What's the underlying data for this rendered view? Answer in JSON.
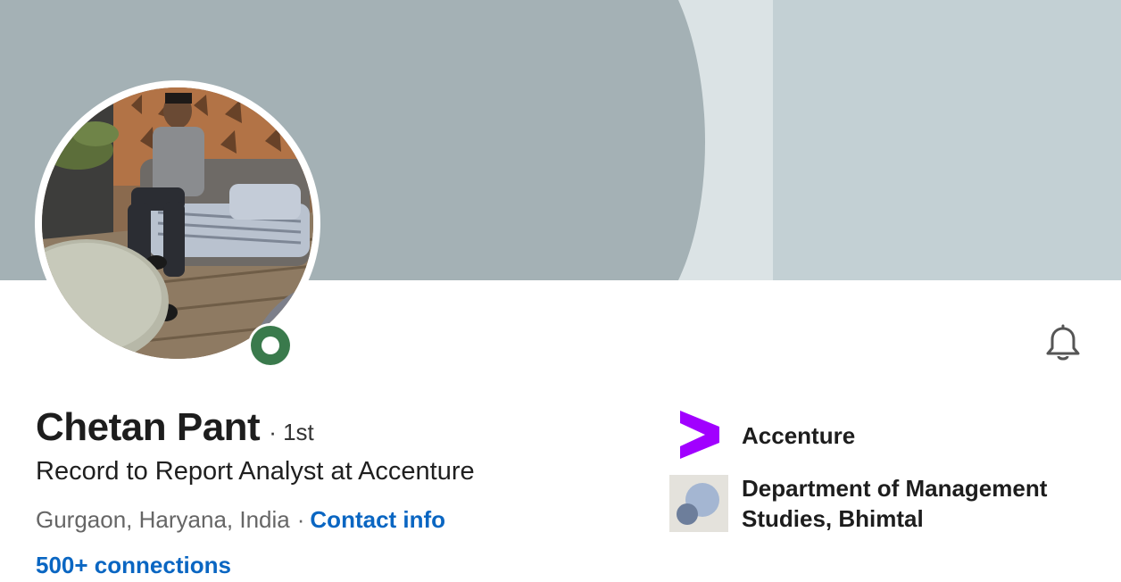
{
  "profile": {
    "name": "Chetan Pant",
    "degree": "· 1st",
    "headline": "Record to Report Analyst at Accenture",
    "location": "Gurgaon, Haryana, India",
    "separator": "·",
    "contact_link": "Contact info",
    "connections": "500+ connections",
    "online_status_color": "#3a7a4c"
  },
  "organizations": {
    "company": {
      "name": "Accenture",
      "logo_icon": "accenture-logo",
      "logo_color": "#a100ff"
    },
    "school": {
      "name": "Department of Management Studies, Bhimtal",
      "logo_icon": "school-logo"
    }
  },
  "actions": {
    "notify_icon": "bell-icon"
  },
  "colors": {
    "link": "#0a66c2",
    "banner": "#a4b1b5"
  }
}
